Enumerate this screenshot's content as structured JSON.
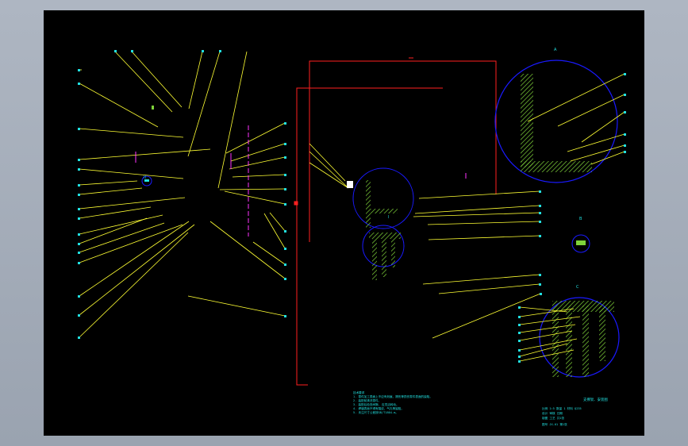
{
  "drawing": {
    "background": "#000000",
    "colors": {
      "leader": "#ffff33",
      "frame": "#ff2020",
      "detail_circle": "#1a1aff",
      "hatch": "#7fd23a",
      "text": "#22e0e0",
      "accent": "#ff33ff"
    },
    "notes": {
      "heading": "技术要求",
      "lines": [
        "1. 零件加工表面上不应有划痕、擦伤等损伤零件表面的缺陷。",
        "2. 装配前清洗零件。",
        "3. 装配后检查间隙, 应灵活转动。",
        "4. 焊缝表面不得有裂纹、气孔等缺陷。",
        "5. 未注尺寸公差按GB/T1804-m。"
      ]
    },
    "title_block": {
      "title": "支撑架、安装图",
      "rows": [
        "比例 1:5   数量 1   材料 Q235",
        "设计        审核         日期",
        "制图        工艺         共1张",
        "图号  JX-01      第1张"
      ]
    },
    "detail_labels": [
      "A",
      "B",
      "C",
      "I",
      "II"
    ]
  }
}
